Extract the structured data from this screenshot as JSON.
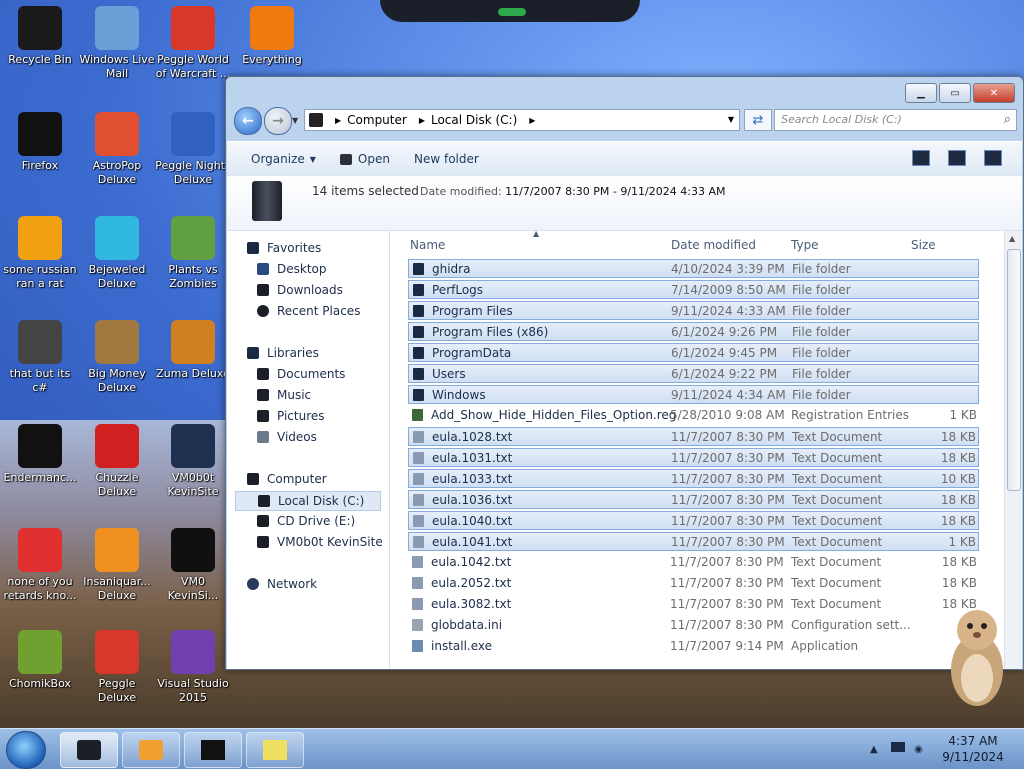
{
  "desktop_icons": [
    {
      "label": "Recycle Bin",
      "icon": "recycle-bin-icon",
      "color": "#1a1a1a"
    },
    {
      "label": "Windows Live Mail",
      "icon": "mail-icon",
      "color": "#6aa0d8"
    },
    {
      "label": "Peggle World of Warcraft ...",
      "icon": "peggle-icon",
      "color": "#d8382a"
    },
    {
      "label": "Everything",
      "icon": "magnifier-icon",
      "color": "#f07a10"
    },
    {
      "label": "Firefox",
      "icon": "app-icon",
      "color": "#111111"
    },
    {
      "label": "AstroPop Deluxe",
      "icon": "astropop-icon",
      "color": "#e05030"
    },
    {
      "label": "Peggle Nights Deluxe",
      "icon": "peggle-icon",
      "color": "#3060c0"
    },
    {
      "label": "some russian ran a rat",
      "icon": "de-icon",
      "color": "#f0a010"
    },
    {
      "label": "Bejeweled Deluxe",
      "icon": "gem-icon",
      "color": "#30b8e0"
    },
    {
      "label": "Plants vs Zombies",
      "icon": "plant-icon",
      "color": "#60a040"
    },
    {
      "label": "that but its c#",
      "icon": "windows-stack-icon",
      "color": "#444444"
    },
    {
      "label": "Big Money Deluxe",
      "icon": "moneybag-icon",
      "color": "#a07840"
    },
    {
      "label": "Zuma Deluxe",
      "icon": "zuma-icon",
      "color": "#d08020"
    },
    {
      "label": "Endermanc...",
      "icon": "app-icon",
      "color": "#111111"
    },
    {
      "label": "Chuzzle Deluxe",
      "icon": "chuzzle-icon",
      "color": "#d02020"
    },
    {
      "label": "VM0b0t KevinSite",
      "icon": "vm-icon",
      "color": "#203050"
    },
    {
      "label": "none of you retards kno...",
      "icon": "shark-icon",
      "color": "#e03030"
    },
    {
      "label": "Insaniquar... Deluxe",
      "icon": "fish-icon",
      "color": "#f09020"
    },
    {
      "label": "VM0 KevinSi...",
      "icon": "vm-icon",
      "color": "#101010"
    },
    {
      "label": "ChomikBox",
      "icon": "chomik-icon",
      "color": "#70a030"
    },
    {
      "label": "Peggle Deluxe",
      "icon": "peggle-icon",
      "color": "#d8382a"
    },
    {
      "label": "Visual Studio 2015",
      "icon": "visual-studio-icon",
      "color": "#7040b0"
    }
  ],
  "window": {
    "address": {
      "crumbs": [
        "Computer",
        "Local Disk (C:)"
      ]
    },
    "search_placeholder": "Search Local Disk (C:)",
    "toolbar": {
      "organize": "Organize",
      "open": "Open",
      "new_folder": "New folder"
    },
    "details": {
      "selected": "14 items selected",
      "date_label": "Date modified:",
      "date_range": "11/7/2007 8:30 PM - 9/11/2024 4:33 AM"
    },
    "nav": {
      "favorites": "Favorites",
      "desktop": "Desktop",
      "downloads": "Downloads",
      "recent": "Recent Places",
      "libraries": "Libraries",
      "documents": "Documents",
      "music": "Music",
      "pictures": "Pictures",
      "videos": "Videos",
      "computer": "Computer",
      "local_disk": "Local Disk (C:)",
      "cd_drive": "CD Drive (E:)",
      "vm": "VM0b0t KevinSite",
      "network": "Network"
    },
    "columns": {
      "name": "Name",
      "date": "Date modified",
      "type": "Type",
      "size": "Size"
    },
    "files": [
      {
        "name": "ghidra",
        "date": "4/10/2024 3:39 PM",
        "type": "File folder",
        "size": "",
        "selected": true,
        "kind": "folder"
      },
      {
        "name": "PerfLogs",
        "date": "7/14/2009 8:50 AM",
        "type": "File folder",
        "size": "",
        "selected": true,
        "kind": "folder"
      },
      {
        "name": "Program Files",
        "date": "9/11/2024 4:33 AM",
        "type": "File folder",
        "size": "",
        "selected": true,
        "kind": "folder"
      },
      {
        "name": "Program Files (x86)",
        "date": "6/1/2024 9:26 PM",
        "type": "File folder",
        "size": "",
        "selected": true,
        "kind": "folder"
      },
      {
        "name": "ProgramData",
        "date": "6/1/2024 9:45 PM",
        "type": "File folder",
        "size": "",
        "selected": true,
        "kind": "folder"
      },
      {
        "name": "Users",
        "date": "6/1/2024 9:22 PM",
        "type": "File folder",
        "size": "",
        "selected": true,
        "kind": "folder"
      },
      {
        "name": "Windows",
        "date": "9/11/2024 4:34 AM",
        "type": "File folder",
        "size": "",
        "selected": true,
        "kind": "folder"
      },
      {
        "name": "Add_Show_Hide_Hidden_Files_Option.reg",
        "date": "5/28/2010 9:08 AM",
        "type": "Registration Entries",
        "size": "1 KB",
        "selected": false,
        "kind": "reg"
      },
      {
        "name": "eula.1028.txt",
        "date": "11/7/2007 8:30 PM",
        "type": "Text Document",
        "size": "18 KB",
        "selected": true,
        "kind": "txt"
      },
      {
        "name": "eula.1031.txt",
        "date": "11/7/2007 8:30 PM",
        "type": "Text Document",
        "size": "18 KB",
        "selected": true,
        "kind": "txt"
      },
      {
        "name": "eula.1033.txt",
        "date": "11/7/2007 8:30 PM",
        "type": "Text Document",
        "size": "10 KB",
        "selected": true,
        "kind": "txt"
      },
      {
        "name": "eula.1036.txt",
        "date": "11/7/2007 8:30 PM",
        "type": "Text Document",
        "size": "18 KB",
        "selected": true,
        "kind": "txt"
      },
      {
        "name": "eula.1040.txt",
        "date": "11/7/2007 8:30 PM",
        "type": "Text Document",
        "size": "18 KB",
        "selected": true,
        "kind": "txt"
      },
      {
        "name": "eula.1041.txt",
        "date": "11/7/2007 8:30 PM",
        "type": "Text Document",
        "size": "1 KB",
        "selected": true,
        "kind": "txt"
      },
      {
        "name": "eula.1042.txt",
        "date": "11/7/2007 8:30 PM",
        "type": "Text Document",
        "size": "18 KB",
        "selected": false,
        "kind": "txt"
      },
      {
        "name": "eula.2052.txt",
        "date": "11/7/2007 8:30 PM",
        "type": "Text Document",
        "size": "18 KB",
        "selected": false,
        "kind": "txt"
      },
      {
        "name": "eula.3082.txt",
        "date": "11/7/2007 8:30 PM",
        "type": "Text Document",
        "size": "18 KB",
        "selected": false,
        "kind": "txt"
      },
      {
        "name": "globdata.ini",
        "date": "11/7/2007 8:30 PM",
        "type": "Configuration sett...",
        "size": "",
        "selected": false,
        "kind": "ini"
      },
      {
        "name": "install.exe",
        "date": "11/7/2007 9:14 PM",
        "type": "Application",
        "size": "",
        "selected": false,
        "kind": "exe"
      }
    ]
  },
  "taskbar": {
    "time": "4:37 AM",
    "date": "9/11/2024"
  }
}
